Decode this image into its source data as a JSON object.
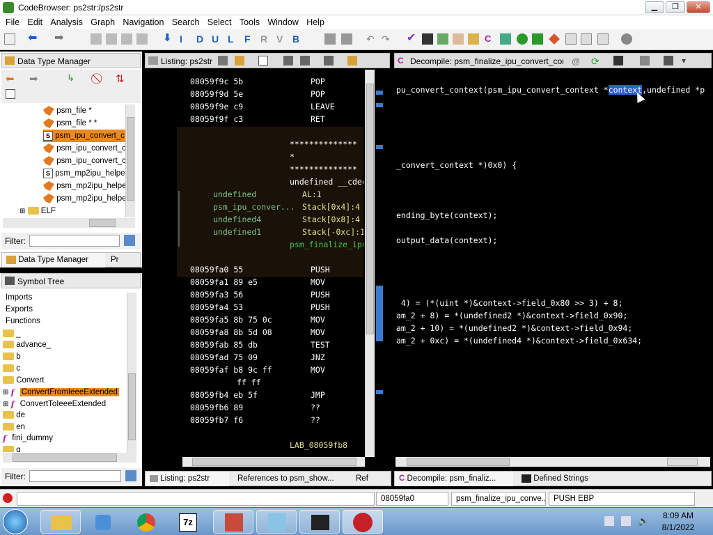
{
  "window": {
    "title": "CodeBrowser: ps2str:/ps2str",
    "min": "▁",
    "max": "❐",
    "close": "✕"
  },
  "menu": [
    "File",
    "Edit",
    "Analysis",
    "Graph",
    "Navigation",
    "Search",
    "Select",
    "Tools",
    "Window",
    "Help"
  ],
  "dtm": {
    "title": "Data Type Manager",
    "items": [
      {
        "label": "psm_file *",
        "icon": "datatype"
      },
      {
        "label": "psm_file * *",
        "icon": "datatype"
      },
      {
        "label": "psm_ipu_convert_c",
        "icon": "struct",
        "selected": true
      },
      {
        "label": "psm_ipu_convert_c",
        "icon": "datatype"
      },
      {
        "label": "psm_ipu_convert_c",
        "icon": "datatype"
      },
      {
        "label": "psm_mp2ipu_helpe",
        "icon": "struct"
      },
      {
        "label": "psm_mp2ipu_helpe",
        "icon": "datatype"
      },
      {
        "label": "psm_mp2ipu_helpe",
        "icon": "datatype"
      },
      {
        "label": "ELF",
        "icon": "folder"
      }
    ],
    "filter_label": "Filter:",
    "tab1": "Data Type Manager",
    "tab2": "Pr"
  },
  "symtree": {
    "title": "Symbol Tree",
    "items": [
      {
        "label": "Imports"
      },
      {
        "label": "Exports"
      },
      {
        "label": "Functions"
      },
      {
        "label": "_"
      },
      {
        "label": "advance_"
      },
      {
        "label": "b"
      },
      {
        "label": "c"
      },
      {
        "label": "Convert"
      },
      {
        "label": "ConvertFromIeeeExtended",
        "selected": true
      },
      {
        "label": "ConvertToIeeeExtended"
      },
      {
        "label": "de"
      },
      {
        "label": "en"
      },
      {
        "label": "fini_dummy"
      },
      {
        "label": "g"
      }
    ],
    "filter_label": "Filter:"
  },
  "listing": {
    "title": "Listing:  ps2str",
    "lines": [
      {
        "addr": "08059f9c",
        "bytes": "5b",
        "op": "POP",
        "args": ""
      },
      {
        "addr": "08059f9d",
        "bytes": "5e",
        "op": "POP",
        "args": ""
      },
      {
        "addr": "08059f9e",
        "bytes": "c9",
        "op": "LEAVE",
        "args": ""
      },
      {
        "addr": "08059f9f",
        "bytes": "c3",
        "op": "RET",
        "args": ""
      }
    ],
    "stars1": "**************",
    "star": "*",
    "stars2": "**************",
    "sig": "undefined __cdec",
    "params": [
      {
        "type": "undefined",
        "loc": "AL:1"
      },
      {
        "type": "psm_ipu_conver...",
        "loc": "Stack[0x4]:4"
      },
      {
        "type": "undefined4",
        "loc": "Stack[0x8]:4"
      },
      {
        "type": "undefined1",
        "loc": "Stack[-0xc]:1"
      }
    ],
    "fname": "psm_finalize_ipu",
    "code": [
      {
        "addr": "08059fa0",
        "bytes": "55",
        "op": "PUSH"
      },
      {
        "addr": "08059fa1",
        "bytes": "89 e5",
        "op": "MOV"
      },
      {
        "addr": "08059fa3",
        "bytes": "56",
        "op": "PUSH"
      },
      {
        "addr": "08059fa4",
        "bytes": "53",
        "op": "PUSH"
      },
      {
        "addr": "08059fa5",
        "bytes": "8b 75 0c",
        "op": "MOV"
      },
      {
        "addr": "08059fa8",
        "bytes": "8b 5d 08",
        "op": "MOV"
      },
      {
        "addr": "08059fab",
        "bytes": "85 db",
        "op": "TEST"
      },
      {
        "addr": "08059fad",
        "bytes": "75 09",
        "op": "JNZ"
      },
      {
        "addr": "08059faf",
        "bytes": "b8 9c ff",
        "op": "MOV"
      },
      {
        "addr": "",
        "bytes": "ff ff",
        "op": ""
      },
      {
        "addr": "08059fb4",
        "bytes": "eb 5f",
        "op": "JMP"
      },
      {
        "addr": "08059fb6",
        "bytes": "89",
        "op": "??"
      },
      {
        "addr": "08059fb7",
        "bytes": "f6",
        "op": "??"
      }
    ],
    "label": "LAB_08059fb8",
    "bottom_tabs": [
      "Listing:  ps2str",
      "References to psm_show...",
      "Ref"
    ]
  },
  "decompile": {
    "title": "Decompile: psm_finalize_ipu_convert_context",
    "hint": "@",
    "lines": [
      "pu_convert_context(psm_ipu_convert_context *",
      "_convert_context *)0x0) {",
      "ending_byte(context);",
      "output_data(context);",
      " 4) = (*(uint *)&context->field_0x80 >> 3) + 8;",
      "am_2 + 8) = *(undefined2 *)&context->field_0x90;",
      "am_2 + 10) = *(undefined2 *)&context->field_0x94;",
      "am_2 + 0xc) = *(undefined4 *)&context->field_0x634;"
    ],
    "highlight": "context",
    "tail": ",undefined *p",
    "bottom_tabs": [
      "Decompile: psm_finaliz...",
      "Defined Strings"
    ]
  },
  "status": {
    "addr": "08059fa0",
    "func": "psm_finalize_ipu_conve...",
    "instr": "PUSH EBP"
  },
  "clock": {
    "time": "8:09 AM",
    "date": "8/1/2022"
  }
}
